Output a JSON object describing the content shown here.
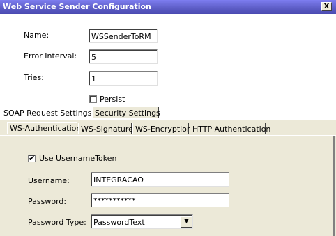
{
  "window": {
    "title": "Web Service Sender Configuration",
    "close_glyph": "X"
  },
  "form": {
    "name_label": "Name:",
    "name_value": "WSSenderToRM",
    "error_label": "Error Interval:",
    "error_value": "5",
    "tries_label": "Tries:",
    "tries_value": "1",
    "persist_label": "Persist",
    "persist_checked": false
  },
  "outer_tabs": [
    {
      "label": "SOAP Request Settings"
    },
    {
      "label": "Security Settings",
      "selected": true
    }
  ],
  "inner_tabs": [
    {
      "label": "WS-Authentication",
      "selected": true
    },
    {
      "label": "WS-Signature"
    },
    {
      "label": "WS-Encryption"
    },
    {
      "label": "HTTP Authentication"
    }
  ],
  "auth": {
    "use_token_label": "Use UsernameToken",
    "use_token_checked": true,
    "check_glyph": "✔",
    "username_label": "Username:",
    "username_value": "INTEGRACAO",
    "password_label": "Password:",
    "password_value": "***********",
    "password_type_label": "Password Type:",
    "password_type_value": "PasswordText",
    "dropdown_glyph": "▼"
  },
  "icons": {
    "close": "close-icon",
    "dropdown": "chevron-down-icon",
    "checkbox": "checkbox-icon"
  }
}
